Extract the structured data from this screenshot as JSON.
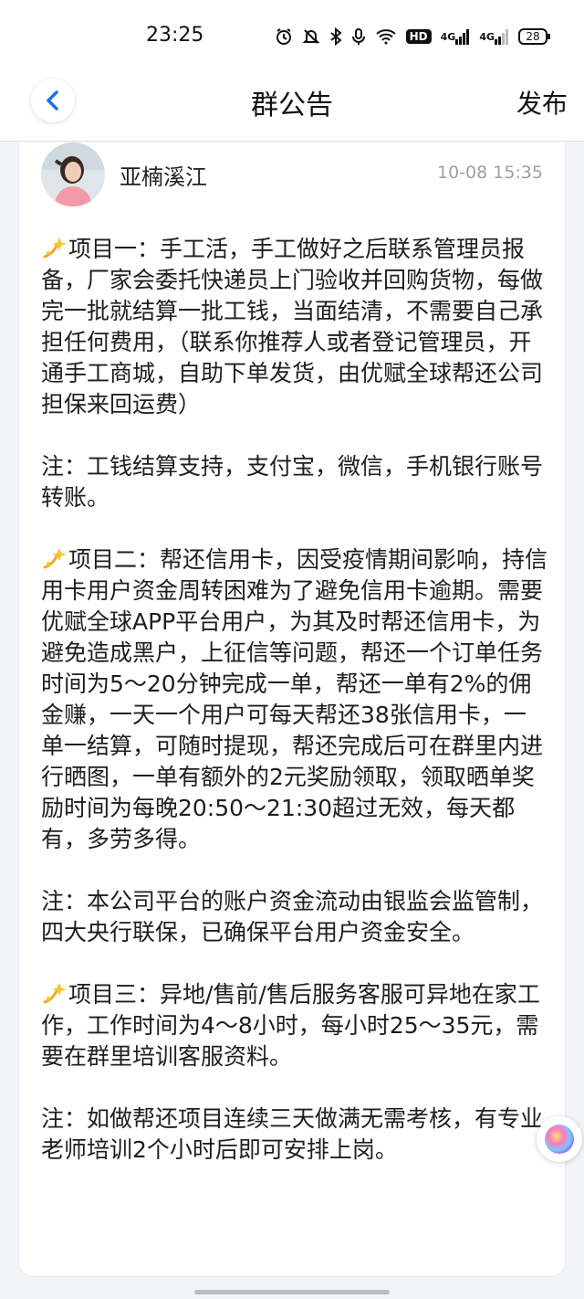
{
  "status_bar": {
    "time": "23:25",
    "hd_label": "HD",
    "network_1": "4G",
    "network_2": "4G",
    "battery": "28",
    "icons": [
      "alarm-icon",
      "mute-icon",
      "bluetooth-icon",
      "mic-icon",
      "wifi-icon",
      "hd-icon",
      "signal-icon",
      "signal-icon",
      "battery-icon"
    ]
  },
  "nav": {
    "back_icon": "chevron-left-icon",
    "title": "群公告",
    "publish_label": "发布"
  },
  "post": {
    "author": "亚楠溪江",
    "time": "10-08 15:35",
    "paragraphs": [
      {
        "emoji": "sparkle-icon",
        "text": "项目一：手工活，手工做好之后联系管理员报备，厂家会委托快递员上门验收并回购货物，每做完一批就结算一批工钱，当面结清，不需要自己承担任何费用，（联系你推荐人或者登记管理员，开通手工商城，自助下单发货，由优赋全球帮还公司担保来回运费）"
      },
      {
        "emoji": "",
        "text": "注：工钱结算支持，支付宝，微信，手机银行账号转账。"
      },
      {
        "emoji": "sparkle-icon",
        "text": "项目二：帮还信用卡，因受疫情期间影响，持信用卡用户资金周转困难为了避免信用卡逾期。需要优赋全球APP平台用户，为其及时帮还信用卡，为避免造成黑户，上征信等问题，帮还一个订单任务时间为5～20分钟完成一单，帮还一单有2%的佣金赚，一天一个用户可每天帮还38张信用卡，一单一结算，可随时提现，帮还完成后可在群里内进行晒图，一单有额外的2元奖励领取，领取晒单奖励时间为每晚20:50～21:30超过无效，每天都有，多劳多得。"
      },
      {
        "emoji": "",
        "text": "注：本公司平台的账户资金流动由银监会监管制，四大央行联保，已确保平台用户资金安全。"
      },
      {
        "emoji": "sparkle-icon",
        "text": "项目三：异地/售前/售后服务客服可异地在家工作，工作时间为4～8小时，每小时25～35元，需要在群里培训客服资料。"
      },
      {
        "emoji": "",
        "text": "注：如做帮还项目连续三天做满无需考核，有专业老师培训2个小时后即可安排上岗。"
      }
    ]
  },
  "colors": {
    "accent_blue": "#1a73e8",
    "text": "#1e1e1e",
    "meta_gray": "#9aa0a6",
    "background": "#f2f4f7"
  }
}
